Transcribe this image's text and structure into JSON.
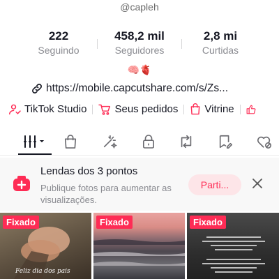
{
  "profile": {
    "handle": "@capleh",
    "emoji_bio": "🧠🫀",
    "link": "https://mobile.capcutshare.com/s/Zs..."
  },
  "stats": [
    {
      "value": "222",
      "label": "Seguindo"
    },
    {
      "value": "458,2 mil",
      "label": "Seguidores"
    },
    {
      "value": "2,8 mi",
      "label": "Curtidas"
    }
  ],
  "shortcuts": [
    {
      "label": "TikTok Studio",
      "icon": "creator-icon"
    },
    {
      "label": "Seus pedidos",
      "icon": "cart-icon"
    },
    {
      "label": "Vitrine",
      "icon": "shopping-bag-icon"
    }
  ],
  "tabs": [
    "videos-grid-icon",
    "shopping-bag-icon",
    "magic-wand-icon",
    "lock-icon",
    "repost-icon",
    "favorites-icon",
    "liked-icon"
  ],
  "banner": {
    "title": "Lendas dos 3 pontos",
    "description": "Publique fotos para aumentar as visualizações.",
    "button": "Parti..."
  },
  "videos": [
    {
      "badge": "Fixado",
      "caption": "Feliz dia dos pais"
    },
    {
      "badge": "Fixado"
    },
    {
      "badge": "Fixado"
    }
  ],
  "colors": {
    "accent": "#fe2c55",
    "text": "#161823",
    "muted": "#8a8b91"
  }
}
